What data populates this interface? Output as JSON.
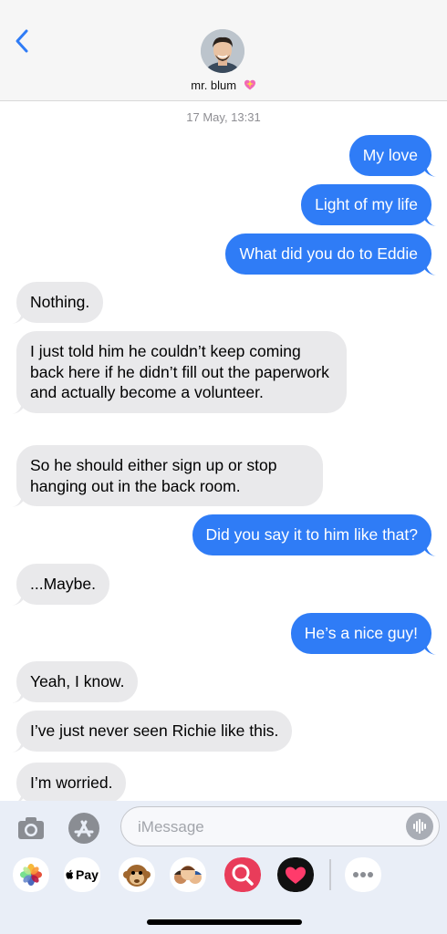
{
  "header": {
    "contact_name": "mr. blum"
  },
  "thread": {
    "timestamp": "17 May, 13:31",
    "messages": [
      {
        "dir": "out",
        "text": "My love"
      },
      {
        "dir": "out",
        "text": "Light of my life"
      },
      {
        "dir": "out",
        "text": "What did you do to Eddie"
      },
      {
        "dir": "in",
        "text": "Nothing."
      },
      {
        "dir": "in",
        "text": "I just told him he couldn’t keep coming back here if he didn’t fill out the paperwork and actually become a volunteer."
      },
      {
        "dir": "in",
        "text": "So he should either sign up or stop hanging out in the back room."
      },
      {
        "dir": "out",
        "text": "Did you say it to him like that?"
      },
      {
        "dir": "in",
        "text": "...Maybe."
      },
      {
        "dir": "out",
        "text": "He’s a nice guy!"
      },
      {
        "dir": "in",
        "text": "Yeah, I know."
      },
      {
        "dir": "in",
        "text": "I’ve just never seen Richie like this."
      },
      {
        "dir": "in",
        "text": "I’m worried."
      }
    ]
  },
  "input": {
    "placeholder": "iMessage"
  },
  "app_drawer": {
    "apple_pay_label": "Pay",
    "items": [
      "photos-icon",
      "apple-pay-icon",
      "animoji-icon",
      "memoji-icon",
      "image-search-icon",
      "digital-touch-icon",
      "more-icon"
    ]
  },
  "colors": {
    "outgoing_bubble": "#2f7cf6",
    "incoming_bubble": "#e9e9eb",
    "accent": "#2f7cf6"
  }
}
